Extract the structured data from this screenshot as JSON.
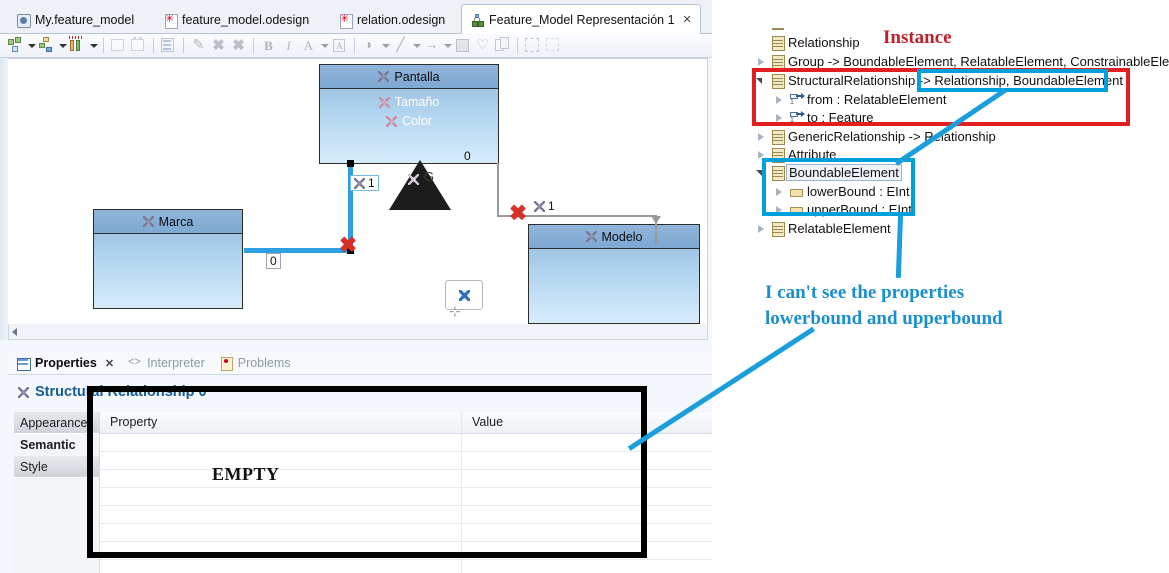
{
  "window": {
    "tabs": [
      {
        "label": "My.feature_model",
        "icon": "model-icon",
        "active": false
      },
      {
        "label": "feature_model.odesign",
        "icon": "odesign-icon",
        "active": false
      },
      {
        "label": "relation.odesign",
        "icon": "odesign-icon",
        "active": false
      },
      {
        "label": "Feature_Model Representación 1",
        "icon": "diagram-icon",
        "active": true,
        "close": "✕"
      }
    ]
  },
  "toolbar": {
    "buttons": [
      {
        "name": "arrange-all",
        "glyph": "▫",
        "enabled": true,
        "dropdown": true
      },
      {
        "name": "align",
        "glyph": "▪",
        "enabled": true,
        "dropdown": true
      },
      {
        "name": "pin-elements",
        "glyph": "▮",
        "enabled": true,
        "dropdown": true
      },
      {
        "name": "open-representation",
        "glyph": "◳",
        "enabled": false
      },
      {
        "name": "new-representation",
        "glyph": "▧",
        "enabled": false
      },
      {
        "name": "layers",
        "glyph": "▤",
        "enabled": false
      },
      {
        "name": "hide-element",
        "glyph": "✎",
        "enabled": false
      },
      {
        "name": "delete-element",
        "glyph": "✖",
        "enabled": false
      },
      {
        "name": "delete-from-model",
        "glyph": "✖",
        "enabled": false
      },
      {
        "name": "bold",
        "glyph": "B",
        "enabled": false
      },
      {
        "name": "italic",
        "glyph": "I",
        "enabled": false
      },
      {
        "name": "font-color",
        "glyph": "A",
        "enabled": false,
        "dropdown": true
      },
      {
        "name": "font-dialog",
        "glyph": "▣",
        "enabled": false
      },
      {
        "name": "fill-color",
        "glyph": "◕",
        "enabled": false,
        "dropdown": true
      },
      {
        "name": "line-color",
        "glyph": "╱",
        "enabled": false,
        "dropdown": true
      },
      {
        "name": "line-style",
        "glyph": "→",
        "enabled": false,
        "dropdown": true
      },
      {
        "name": "image-style",
        "glyph": "▩",
        "enabled": false
      },
      {
        "name": "reset-style",
        "glyph": "◊",
        "enabled": false
      },
      {
        "name": "copy-appearance",
        "glyph": "▤",
        "enabled": false
      },
      {
        "name": "auto-size",
        "glyph": "⬚",
        "enabled": false
      },
      {
        "name": "snap",
        "glyph": "⬚",
        "enabled": false
      }
    ]
  },
  "diagram": {
    "nodes": [
      {
        "id": "pantalla",
        "title": "Pantalla",
        "features": [
          "Tamaño",
          "Color"
        ]
      },
      {
        "id": "marca",
        "title": "Marca",
        "features": []
      },
      {
        "id": "modelo",
        "title": "Modelo",
        "features": []
      }
    ],
    "cardinalities": [
      "1",
      "0",
      "0",
      "1"
    ],
    "group_label": "G"
  },
  "properties": {
    "view_tabs": [
      {
        "label": "Properties",
        "active": true,
        "close": "✕",
        "icon": "properties-icon"
      },
      {
        "label": "Interpreter",
        "active": false,
        "icon": "interpreter-icon"
      },
      {
        "label": "Problems",
        "active": false,
        "icon": "problems-icon"
      }
    ],
    "title": "Structural Relationship 0",
    "side_tabs": [
      {
        "label": "Appearance",
        "active": false
      },
      {
        "label": "Semantic",
        "active": true
      },
      {
        "label": "Style",
        "active": false
      }
    ],
    "columns": [
      "Property",
      "Value"
    ],
    "rows": [],
    "empty_label": "EMPTY"
  },
  "tree": {
    "items": [
      {
        "label": "Relationship",
        "icon": "eclass-icon",
        "indent": 0,
        "expander": "none",
        "selected": false
      },
      {
        "label": "Group -> BoundableElement, RelatableElement, ConstrainableElement",
        "icon": "eclass-icon",
        "indent": 0,
        "expander": "collapsed",
        "selected": false
      },
      {
        "label": "StructuralRelationship -> Relationship, BoundableElement",
        "icon": "eclass-icon",
        "indent": 0,
        "expander": "expanded",
        "selected": false
      },
      {
        "label": "from : RelatableElement",
        "icon": "ereference-icon",
        "indent": 1,
        "expander": "collapsed",
        "selected": false
      },
      {
        "label": "to : Feature",
        "icon": "ereference-icon",
        "indent": 1,
        "expander": "collapsed",
        "selected": false
      },
      {
        "label": "GenericRelationship -> Relationship",
        "icon": "eclass-icon",
        "indent": 0,
        "expander": "collapsed",
        "selected": false
      },
      {
        "label": "Attribute",
        "icon": "eclass-icon",
        "indent": 0,
        "expander": "collapsed",
        "selected": false
      },
      {
        "label": "BoundableElement",
        "icon": "eclass-icon",
        "indent": 0,
        "expander": "expanded",
        "selected": true
      },
      {
        "label": "lowerBound : EInt",
        "icon": "eattribute-icon",
        "indent": 1,
        "expander": "collapsed",
        "selected": false
      },
      {
        "label": "upperBound : EInt",
        "icon": "eattribute-icon",
        "indent": 1,
        "expander": "collapsed",
        "selected": false
      },
      {
        "label": "RelatableElement",
        "icon": "eclass-icon",
        "indent": 0,
        "expander": "collapsed",
        "selected": false
      }
    ]
  },
  "annotations": {
    "instance_label": "Instance",
    "note_line1": "I can't see the properties",
    "note_line2": "lowerbound and upperbound",
    "colors": {
      "red": "#e02020",
      "cyan": "#00a0dc",
      "instance_red": "#c0202a",
      "note_blue": "#1a8fd0",
      "black": "#000000"
    }
  }
}
